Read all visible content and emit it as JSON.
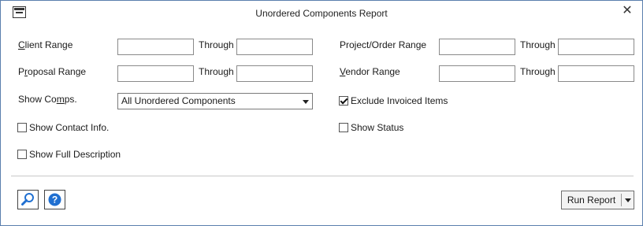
{
  "window": {
    "title": "Unordered Components Report"
  },
  "fields": {
    "client_range": {
      "pre": "",
      "mnemonic": "C",
      "post": "lient Range"
    },
    "proposal_range": {
      "pre": "P",
      "mnemonic": "r",
      "post": "oposal Range"
    },
    "show_comps": {
      "pre": "Show Co",
      "mnemonic": "m",
      "post": "ps."
    },
    "project_order_range": {
      "label": "Project/Order Range"
    },
    "vendor_range": {
      "pre": "",
      "mnemonic": "V",
      "post": "endor Range"
    },
    "through": "Through"
  },
  "show_comps_select": {
    "value": "All Unordered Components"
  },
  "checkboxes": {
    "exclude_invoiced": {
      "label": "Exclude Invoiced Items",
      "checked": true
    },
    "show_contact_info": {
      "label": "Show Contact Info.",
      "checked": false
    },
    "show_status": {
      "label": "Show Status",
      "checked": false
    },
    "show_full_description": {
      "label": "Show Full Description",
      "checked": false
    }
  },
  "footer": {
    "run_report_label": "Run Report"
  },
  "colors": {
    "window_border": "#5b7fae",
    "help_blue": "#1f6fd1"
  },
  "icons": [
    "app-window-icon",
    "close-icon",
    "search-icon",
    "help-icon",
    "chevron-down-icon"
  ]
}
